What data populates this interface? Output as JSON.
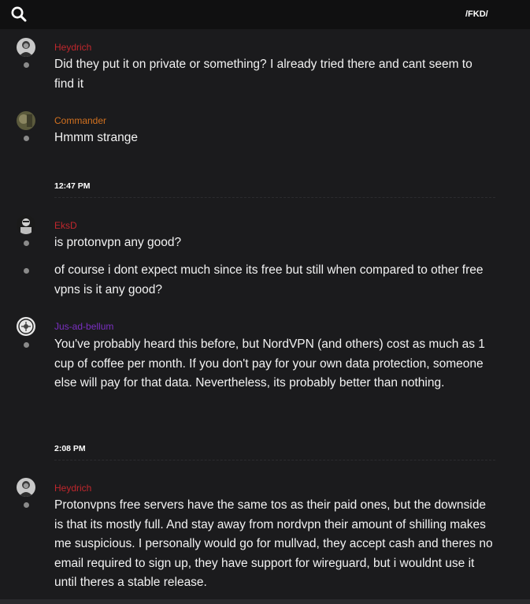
{
  "header": {
    "channel": "/FKD/"
  },
  "icons": {
    "search": "search-icon",
    "avatar": "avatar-icon",
    "bullet": "bullet-dot-icon"
  },
  "colors": {
    "background": "#1b1b1d",
    "topbar": "#101011",
    "heydrich": "#c0272d",
    "commander": "#d2711f",
    "eksd": "#c0272d",
    "jus_ad_bellum": "#7a2fc1"
  },
  "messages": [
    {
      "author": "Heydrich",
      "lines": [
        "Did they put it on private or something? I already tried there and cant seem to find it"
      ]
    },
    {
      "author": "Commander",
      "lines": [
        "Hmmm strange"
      ]
    },
    {
      "author": "EksD",
      "lines": [
        "is protonvpn any good?",
        "of course i dont expect much since its free but still when compared to other free vpns is it any good?"
      ]
    },
    {
      "author": "Jus-ad-bellum",
      "lines": [
        "You've probably heard this before, but NordVPN (and others) cost as much as 1 cup of coffee per month. If you don't pay for your own data protection, someone else will pay for that data. Nevertheless, its probably better than nothing."
      ]
    },
    {
      "author": "Heydrich",
      "lines": [
        "Protonvpns free servers have the same tos as their paid ones, but the downside is that its mostly full. And stay away from nordvpn their amount of shilling makes me suspicious. I personally would go for mullvad, they accept cash and theres no email required to sign up, they have support for wireguard, but i wouldnt use it until theres a stable release."
      ]
    }
  ],
  "timestamps": [
    "12:47 PM",
    "2:08 PM"
  ]
}
